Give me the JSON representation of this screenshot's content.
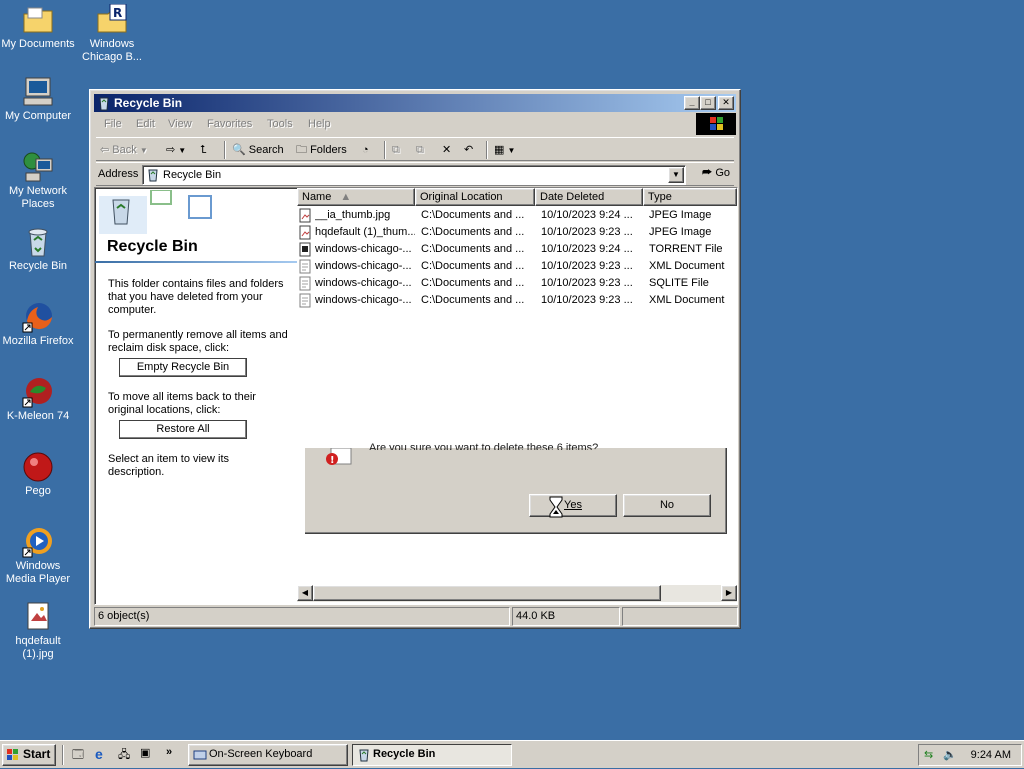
{
  "desktop": {
    "icons": [
      {
        "line1": "My Documents",
        "line2": ""
      },
      {
        "line1": "Windows",
        "line2": "Chicago B..."
      },
      {
        "line1": "My Computer",
        "line2": ""
      },
      {
        "line1": "My Network",
        "line2": "Places"
      },
      {
        "line1": "Recycle Bin",
        "line2": ""
      },
      {
        "line1": "Mozilla Firefox",
        "line2": ""
      },
      {
        "line1": "K-Meleon 74",
        "line2": ""
      },
      {
        "line1": "Pego",
        "line2": ""
      },
      {
        "line1": "Windows",
        "line2": "Media Player"
      },
      {
        "line1": "hqdefault",
        "line2": "(1).jpg"
      }
    ]
  },
  "window": {
    "title": "Recycle Bin",
    "menu": [
      "File",
      "Edit",
      "View",
      "Favorites",
      "Tools",
      "Help"
    ],
    "toolbar": {
      "back": "Back",
      "search": "Search",
      "folders": "Folders"
    },
    "address": {
      "label": "Address",
      "value": "Recycle Bin",
      "go": "Go"
    },
    "left_panel": {
      "title": "Recycle Bin",
      "desc": "This folder contains files and folders that you have deleted from your computer.",
      "empty_hint": "To permanently remove all items and reclaim disk space, click:",
      "empty_btn": "Empty Recycle Bin",
      "restore_hint": "To move all items back to their original locations, click:",
      "restore_btn": "Restore All",
      "select_hint": "Select an item to view its description."
    },
    "columns": [
      "Name",
      "Original Location",
      "Date Deleted",
      "Type"
    ],
    "rows": [
      {
        "name": "__ia_thumb.jpg",
        "location": "C:\\Documents and ...",
        "date": "10/10/2023 9:24 ...",
        "type": "JPEG Image",
        "icon": "jpeg-file-icon"
      },
      {
        "name": "hqdefault (1)_thum...",
        "location": "C:\\Documents and ...",
        "date": "10/10/2023 9:23 ...",
        "type": "JPEG Image",
        "icon": "jpeg-file-icon"
      },
      {
        "name": "windows-chicago-...",
        "location": "C:\\Documents and ...",
        "date": "10/10/2023 9:24 ...",
        "type": "TORRENT File",
        "icon": "torrent-file-icon"
      },
      {
        "name": "windows-chicago-...",
        "location": "C:\\Documents and ...",
        "date": "10/10/2023 9:23 ...",
        "type": "XML Document",
        "icon": "xml-file-icon"
      },
      {
        "name": "windows-chicago-...",
        "location": "C:\\Documents and ...",
        "date": "10/10/2023 9:23 ...",
        "type": "SQLITE File",
        "icon": "sqlite-file-icon"
      },
      {
        "name": "windows-chicago-...",
        "location": "C:\\Documents and ...",
        "date": "10/10/2023 9:23 ...",
        "type": "XML Document",
        "icon": "xml-file-icon"
      }
    ],
    "dialog": {
      "message": "Are you sure you want to delete these 6 items?",
      "yes": "Yes",
      "no": "No"
    },
    "status": {
      "objects": "6 object(s)",
      "size": "44.0 KB"
    }
  },
  "taskbar": {
    "start": "Start",
    "tasks": [
      "On-Screen Keyboard",
      "Recycle Bin"
    ],
    "clock": "9:24 AM"
  },
  "colors": {
    "desktop": "#3a6ea5",
    "title_start": "#0a246a",
    "title_end": "#a6caf0",
    "face": "#d4d0c8"
  }
}
